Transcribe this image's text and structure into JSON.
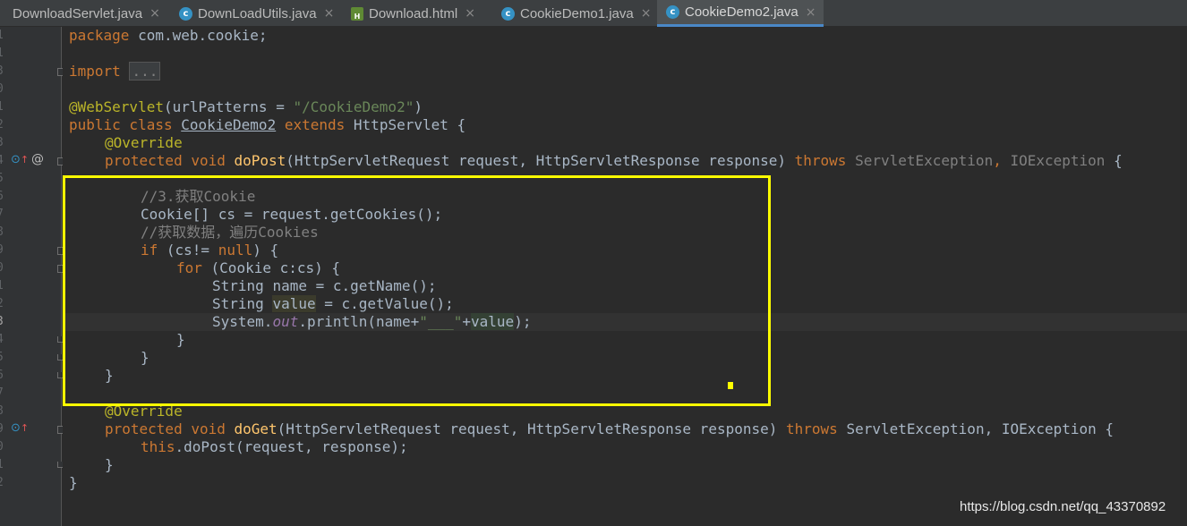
{
  "tabs": [
    {
      "label": "DownloadServlet.java",
      "icon": "java-class-icon"
    },
    {
      "label": "DownLoadUtils.java",
      "icon": "java-class-icon"
    },
    {
      "label": "Download.html",
      "icon": "html-file-icon"
    },
    {
      "label": "CookieDemo1.java",
      "icon": "java-class-icon"
    },
    {
      "label": "CookieDemo2.java",
      "icon": "java-class-icon",
      "active": true
    }
  ],
  "close_glyph": "×",
  "gutter": {
    "line_numbers": [
      "1",
      "1",
      "3",
      "0",
      "1",
      "2",
      "3",
      "4",
      "5",
      "6",
      "7",
      "8",
      "9",
      "0",
      "1",
      "2",
      "3",
      "4",
      "5",
      "6",
      "7",
      "8",
      "9",
      "0",
      "1",
      "2"
    ],
    "override_glyph": "@"
  },
  "code": {
    "package_kw": "package",
    "package_name": " com.web.cookie;",
    "import_kw": "import",
    "import_collapsed": "...",
    "annotation": "@WebServlet",
    "annotation_open": "(urlPatterns = ",
    "annotation_value": "\"/CookieDemo2\"",
    "annotation_close": ")",
    "class_kw": "public class",
    "class_name": "CookieDemo2",
    "extends_kw": "extends",
    "superclass": " HttpServlet {",
    "override1": "@Override",
    "dopost_mods": "protected void",
    "dopost_name": "doPost",
    "dopost_params": "(HttpServletRequest request, HttpServletResponse response) ",
    "throws_kw": "throws",
    "dopost_ex1": " ServletException",
    "dopost_comma": ",",
    "dopost_ex2": " IOException",
    "dopost_open": " {",
    "comment1": "//3.获取Cookie",
    "cookies_decl": "Cookie[] cs = request.getCookies();",
    "comment2": "//获取数据，遍历Cookies",
    "if_kw": "if",
    "if_cond": " (cs!= ",
    "null_kw": "null",
    "if_open": ") {",
    "for_kw": "for",
    "for_body": " (Cookie c:cs) {",
    "name_decl_a": "String ",
    "name_var": "name",
    "name_decl_b": " = c.getName();",
    "value_decl_a": "String ",
    "value_var": "value",
    "value_decl_b": " = c.getValue();",
    "println_a": "System.",
    "println_out": "out",
    "println_b": ".println(name+",
    "println_str": "\"___\"",
    "println_c": "+",
    "println_value": "value",
    "println_d": ");",
    "brace_close": "}",
    "override2": "@Override",
    "doget_mods": "protected void",
    "doget_name": "doGet",
    "doget_params": "(HttpServletRequest request, HttpServletResponse response) ",
    "doget_throws": "throws",
    "doget_ex": " ServletException, IOException {",
    "this_kw": "this",
    "doget_body": ".doPost(request, response);"
  },
  "watermark": "https://blog.csdn.net/qq_43370892",
  "colors": {
    "highlight_box": "#ffff00",
    "active_tab_underline": "#4a88c7",
    "keyword": "#cc7832",
    "string": "#6a8759",
    "annotation": "#bbb529",
    "comment": "#808080"
  }
}
